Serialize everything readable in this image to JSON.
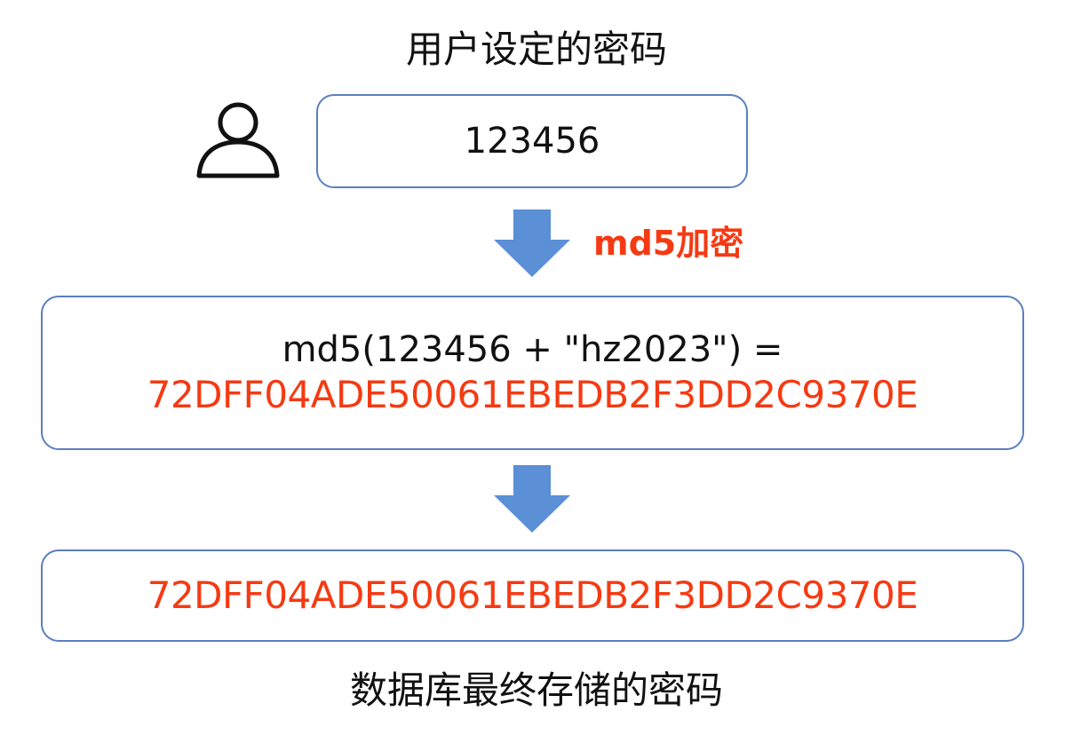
{
  "header": {
    "title": "用户设定的密码"
  },
  "user_input": {
    "icon": "user-icon",
    "password": "123456"
  },
  "step1": {
    "arrow_icon": "arrow-down-icon",
    "label": "md5加密",
    "label_color": "#f53a13"
  },
  "formula": {
    "expression": "md5(123456 + \"hz2023\") =",
    "result": "72DFF04ADE50061EBEDB2F3DD2C9370E"
  },
  "step2": {
    "arrow_icon": "arrow-down-icon"
  },
  "stored": {
    "hash": "72DFF04ADE50061EBEDB2F3DD2C9370E"
  },
  "footer": {
    "title": "数据库最终存储的密码"
  },
  "colors": {
    "accent": "#f53a13",
    "box_border": "#5b7fbf",
    "arrow": "#5b8fd6"
  }
}
